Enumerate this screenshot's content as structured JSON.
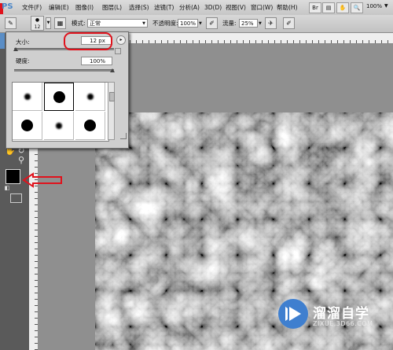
{
  "app": {
    "logo": "PS"
  },
  "menubar": {
    "items": [
      {
        "label": "文件(F)"
      },
      {
        "label": "编辑(E)"
      },
      {
        "label": "图像(I)"
      },
      {
        "label": "图层(L)"
      },
      {
        "label": "选择(S)"
      },
      {
        "label": "滤镜(T)"
      },
      {
        "label": "分析(A)"
      },
      {
        "label": "3D(D)"
      },
      {
        "label": "视图(V)"
      },
      {
        "label": "窗口(W)"
      },
      {
        "label": "帮助(H)"
      }
    ],
    "zoom": "100%"
  },
  "options": {
    "brush_size_badge": "12",
    "mode_label": "模式:",
    "mode_value": "正常",
    "opacity_label": "不透明度:",
    "opacity_value": "100%",
    "flow_label": "流量:",
    "flow_value": "25%"
  },
  "brush_panel": {
    "size_label": "大小:",
    "size_value": "12 px",
    "hardness_label": "硬度:",
    "hardness_value": "100%",
    "presets": [
      {
        "kind": "soft-small"
      },
      {
        "kind": "hard-large"
      },
      {
        "kind": "soft-small"
      },
      {
        "kind": "hard-large"
      },
      {
        "kind": "soft-small"
      },
      {
        "kind": "hard-large"
      }
    ]
  },
  "watermark": {
    "title": "溜溜自学",
    "url": "ZIXUE.3D66.COM"
  },
  "colors": {
    "annotation_red": "#e0121c",
    "workspace": "#8f8f8f",
    "foreground_color": "#000000"
  }
}
